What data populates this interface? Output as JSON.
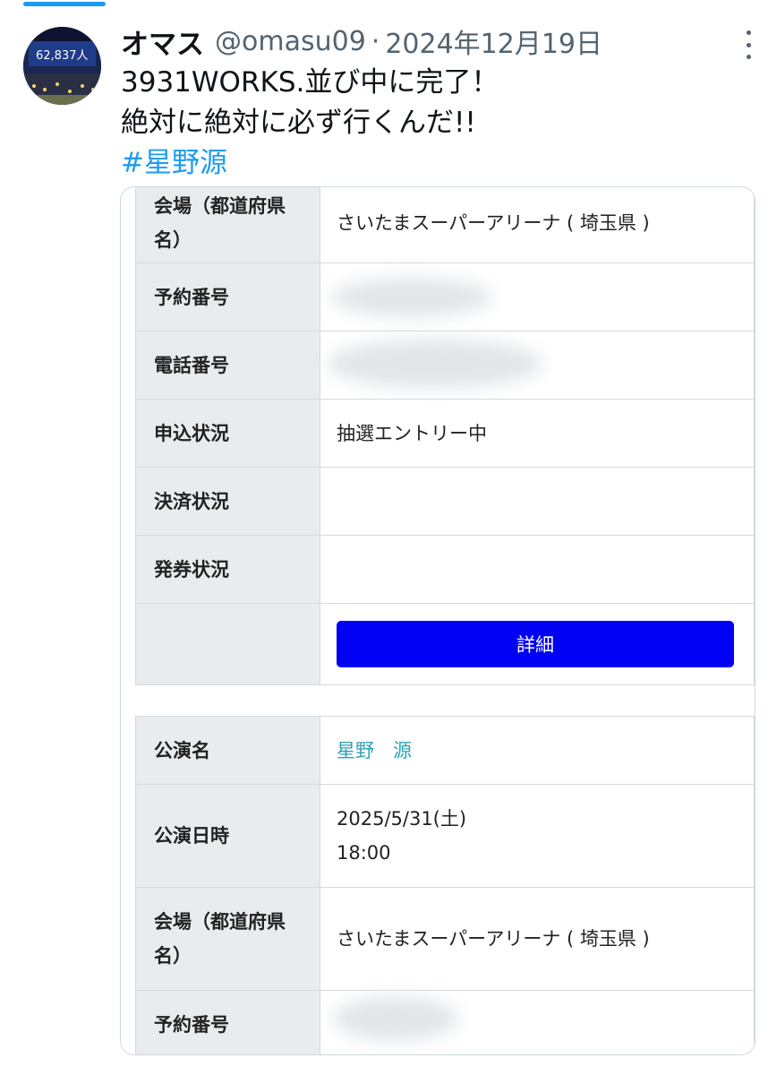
{
  "tweet": {
    "display_name": "オマス",
    "handle": "@omasu09",
    "separator": "·",
    "date": "2024年12月19日",
    "lines": [
      "3931WORKS.並び中に完了！",
      "絶対に絶対に必ず行くんだ!!"
    ],
    "hashtag": "#星野源",
    "avatar_text": "62,837人"
  },
  "ticket1": {
    "venue_label": "会場（都道府県名）",
    "venue_value": "さいたまスーパーアリーナ ( 埼玉県 )",
    "reservation_label": "予約番号",
    "phone_label": "電話番号",
    "status_label": "申込状況",
    "status_value": "抽選エントリー中",
    "payment_label": "決済状況",
    "issue_label": "発券状況",
    "detail_button": "詳細"
  },
  "ticket2": {
    "performance_label": "公演名",
    "performance_value": "星野　源",
    "datetime_label": "公演日時",
    "date_value": "2025/5/31(土)",
    "time_value": "18:00",
    "venue_label": "会場（都道府県名）",
    "venue_value": "さいたまスーパーアリーナ ( 埼玉県 )",
    "reservation_label": "予約番号"
  },
  "colors": {
    "accent": "#1d9bf0",
    "button": "#0000f5",
    "link": "#2aa3b5",
    "header_cell": "#e9ecee"
  }
}
